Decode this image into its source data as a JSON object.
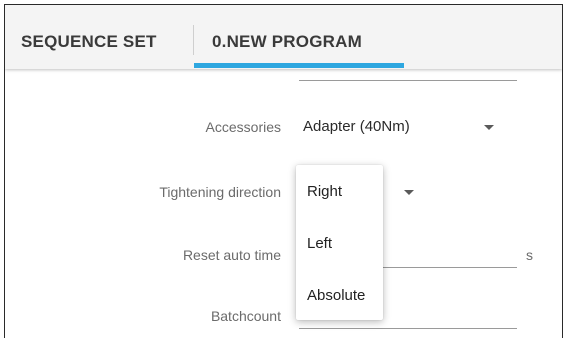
{
  "tabs": [
    {
      "label": "SEQUENCE SET"
    },
    {
      "label": "0.NEW PROGRAM"
    }
  ],
  "form": {
    "accessories": {
      "label": "Accessories",
      "value": "Adapter (40Nm)"
    },
    "tightening_direction": {
      "label": "Tightening direction"
    },
    "reset_auto_time": {
      "label": "Reset auto time",
      "unit": "s"
    },
    "batchcount": {
      "label": "Batchcount"
    }
  },
  "dropdown": {
    "options": [
      "Right",
      "Left",
      "Absolute"
    ]
  },
  "colors": {
    "tab_indicator": "#2ea7e0",
    "tab_bar_bg": "#f4f4f4"
  }
}
